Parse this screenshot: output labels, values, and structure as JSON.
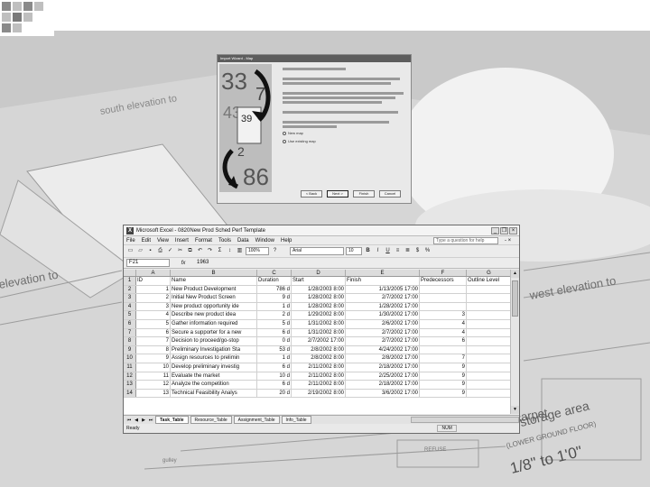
{
  "background": {
    "label_south": "south elevation to",
    "label_west_left": "elevation to",
    "label_west_right": "west elevation to",
    "label_carpet": "carpet",
    "label_storage": "storage area",
    "label_floor": "(LOWER GROUND FLOOR)",
    "label_scale": "1/8\" to 1'0\"",
    "label_refuse": "REFUSE",
    "label_gulley": "gulley"
  },
  "wizard": {
    "title": "Import Wizard - Map",
    "lines_block1": 3,
    "lines_block2": 3,
    "lines_block3": 3,
    "option_new": "New map",
    "option_existing": "Use existing map",
    "btn_back": "< Back",
    "btn_next": "Next >",
    "btn_finish": "Finish",
    "btn_cancel": "Cancel",
    "art_numbers": [
      "33",
      "7",
      "43",
      "39",
      "2",
      "86"
    ]
  },
  "excel": {
    "title": "Microsoft Excel - 0820New Prod Sched Perf Template",
    "menu": [
      "File",
      "Edit",
      "View",
      "Insert",
      "Format",
      "Tools",
      "Data",
      "Window",
      "Help"
    ],
    "help_placeholder": "Type a question for help",
    "zoom": "100%",
    "font_name": "Arial",
    "font_size": "10",
    "name_box": "F21",
    "formula_value": "1963",
    "columns": [
      "A",
      "B",
      "C",
      "D",
      "E",
      "F",
      "G"
    ],
    "headers": [
      "ID",
      "Name",
      "Duration",
      "Start",
      "Finish",
      "Predecessors",
      "Outline Level"
    ],
    "rows": [
      {
        "rn": "2",
        "a": "1",
        "b": "New Product Development",
        "c": "786 d",
        "d": "1/28/2003 8:00",
        "e": "1/13/2005 17:00",
        "f": ""
      },
      {
        "rn": "3",
        "a": "2",
        "b": "Initial New Product Screen",
        "c": "9 d",
        "d": "1/28/2002 8:00",
        "e": "2/7/2002 17:00",
        "f": ""
      },
      {
        "rn": "4",
        "a": "3",
        "b": "New product opportunity ide",
        "c": "1 d",
        "d": "1/28/2002 8:00",
        "e": "1/28/2002 17:00",
        "f": ""
      },
      {
        "rn": "5",
        "a": "4",
        "b": "Describe new product idea",
        "c": "2 d",
        "d": "1/29/2002 8:00",
        "e": "1/30/2002 17:00",
        "f": "3"
      },
      {
        "rn": "6",
        "a": "5",
        "b": "Gather information required",
        "c": "5 d",
        "d": "1/31/2002 8:00",
        "e": "2/6/2002 17:00",
        "f": "4"
      },
      {
        "rn": "7",
        "a": "6",
        "b": "Secure a supporter for a new",
        "c": "6 d",
        "d": "1/31/2002 8:00",
        "e": "2/7/2002 17:00",
        "f": "4"
      },
      {
        "rn": "8",
        "a": "7",
        "b": "Decision to proceed/go-stop",
        "c": "0 d",
        "d": "2/7/2002 17:00",
        "e": "2/7/2002 17:00",
        "f": "6"
      },
      {
        "rn": "9",
        "a": "8",
        "b": "Preliminary Investigation Sta",
        "c": "53 d",
        "d": "2/8/2002 8:00",
        "e": "4/24/2002 17:00",
        "f": ""
      },
      {
        "rn": "10",
        "a": "9",
        "b": "Assign resources to prelimin",
        "c": "1 d",
        "d": "2/8/2002 8:00",
        "e": "2/8/2002 17:00",
        "f": "7"
      },
      {
        "rn": "11",
        "a": "10",
        "b": "Develop preliminary investig",
        "c": "6 d",
        "d": "2/11/2002 8:00",
        "e": "2/18/2002 17:00",
        "f": "9"
      },
      {
        "rn": "12",
        "a": "11",
        "b": "Evaluate the market",
        "c": "10 d",
        "d": "2/11/2002 8:00",
        "e": "2/25/2002 17:00",
        "f": "9"
      },
      {
        "rn": "13",
        "a": "12",
        "b": "Analyze the competition",
        "c": "6 d",
        "d": "2/11/2002 8:00",
        "e": "2/18/2002 17:00",
        "f": "9"
      },
      {
        "rn": "14",
        "a": "13",
        "b": "Technical Feasibility Analys",
        "c": "20 d",
        "d": "2/19/2002 8:00",
        "e": "3/6/2002 17:00",
        "f": "9"
      }
    ],
    "tabs": [
      "Task_Table",
      "Resource_Table",
      "Assignment_Table",
      "Info_Table"
    ],
    "status_left": "Ready",
    "status_right": "NUM"
  }
}
